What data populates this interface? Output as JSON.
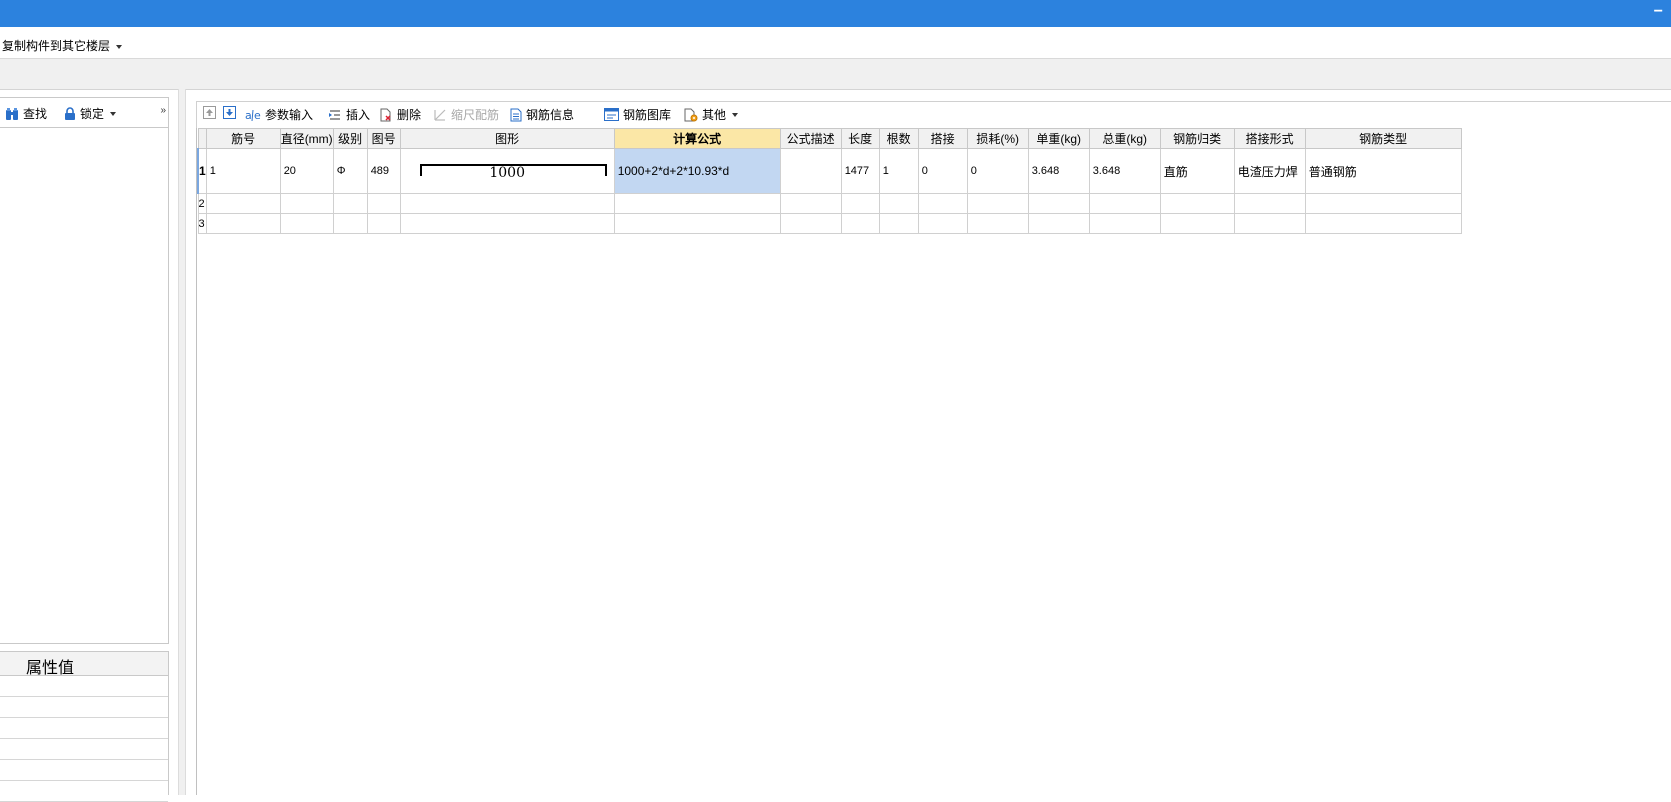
{
  "window": {
    "minimize_glyph": "−"
  },
  "menu": {
    "copy_to_floor": "复制构件到其它楼层"
  },
  "left_toolbar": {
    "find": "查找",
    "lock": "锁定",
    "expand": "»"
  },
  "properties": {
    "header_value": "属性值"
  },
  "toolbar": {
    "param_input": "参数输入",
    "insert": "插入",
    "delete": "删除",
    "scale_rebar": "缩尺配筋",
    "rebar_info": "钢筋信息",
    "rebar_library": "钢筋图库",
    "other": "其他"
  },
  "grid": {
    "columns": [
      "筋号",
      "直径(mm)",
      "级别",
      "图号",
      "图形",
      "计算公式",
      "公式描述",
      "长度",
      "根数",
      "搭接",
      "损耗(%)",
      "单重(kg)",
      "总重(kg)",
      "钢筋归类",
      "搭接形式",
      "钢筋类型"
    ],
    "active_column": "计算公式",
    "rows": [
      {
        "row_no": "1",
        "bar_no": "1",
        "diameter": "20",
        "grade": "Φ",
        "figure_no": "489",
        "shape_value": "1000",
        "formula": "1000+2*d+2*10.93*d",
        "formula_desc": "",
        "length": "1477",
        "count": "1",
        "lap": "0",
        "loss": "0",
        "unit_weight": "3.648",
        "total_weight": "3.648",
        "category": "直筋",
        "lap_type": "电渣压力焊",
        "rebar_type": "普通钢筋"
      },
      {
        "row_no": "2"
      },
      {
        "row_no": "3"
      }
    ]
  },
  "colors": {
    "title_bar": "#2c82de",
    "active_header": "#fbe7a6",
    "selected_cell": "#c2d7f2"
  }
}
